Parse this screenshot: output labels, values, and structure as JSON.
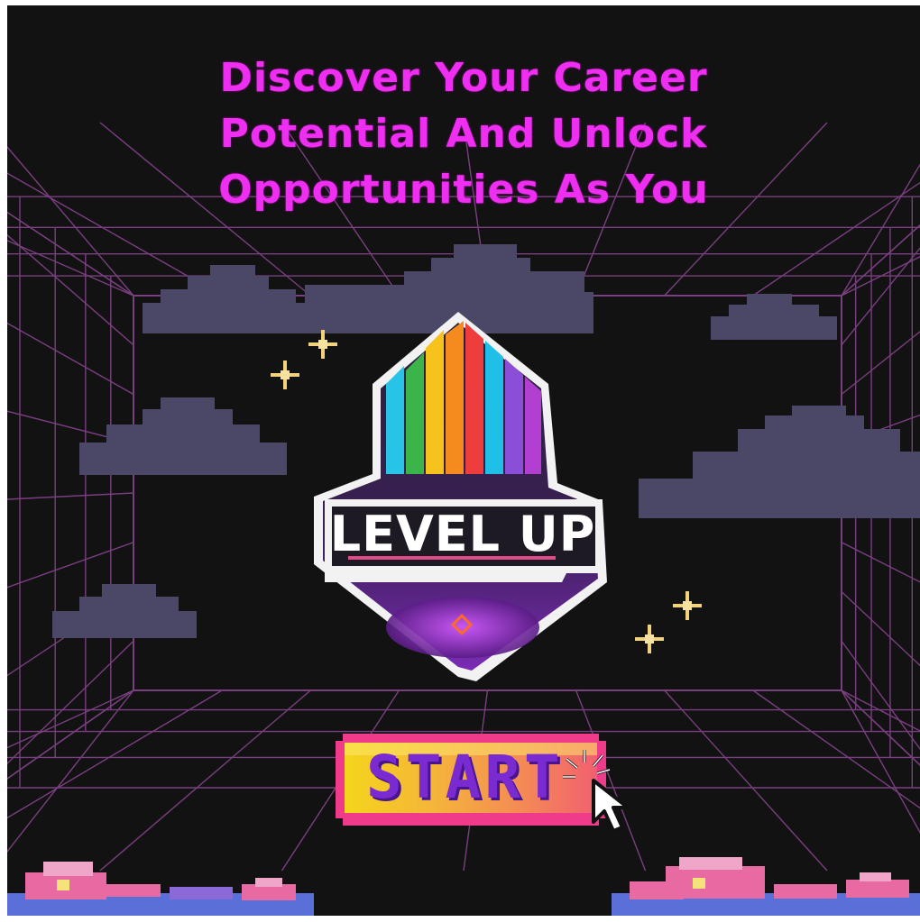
{
  "headline": {
    "line1": "Discover Your Career",
    "line2": "Potential And Unlock",
    "line3": "Opportunities As You"
  },
  "logo": {
    "text": "LEVEL UP"
  },
  "start_button": {
    "label": "START"
  },
  "colors": {
    "background": "#121212",
    "grid": "#7a3f80",
    "headline": "#ee2ef0",
    "cloud": "#4a4866",
    "sparkle": "#f2d27a",
    "button_border": "#f03a8a",
    "button_fill": "#f5c42c",
    "button_text": "#7a2ad1"
  },
  "icons": {
    "cursor": "pointer-arrow-icon",
    "sparkle": "sparkle-icon",
    "logo": "level-up-logo-icon"
  }
}
